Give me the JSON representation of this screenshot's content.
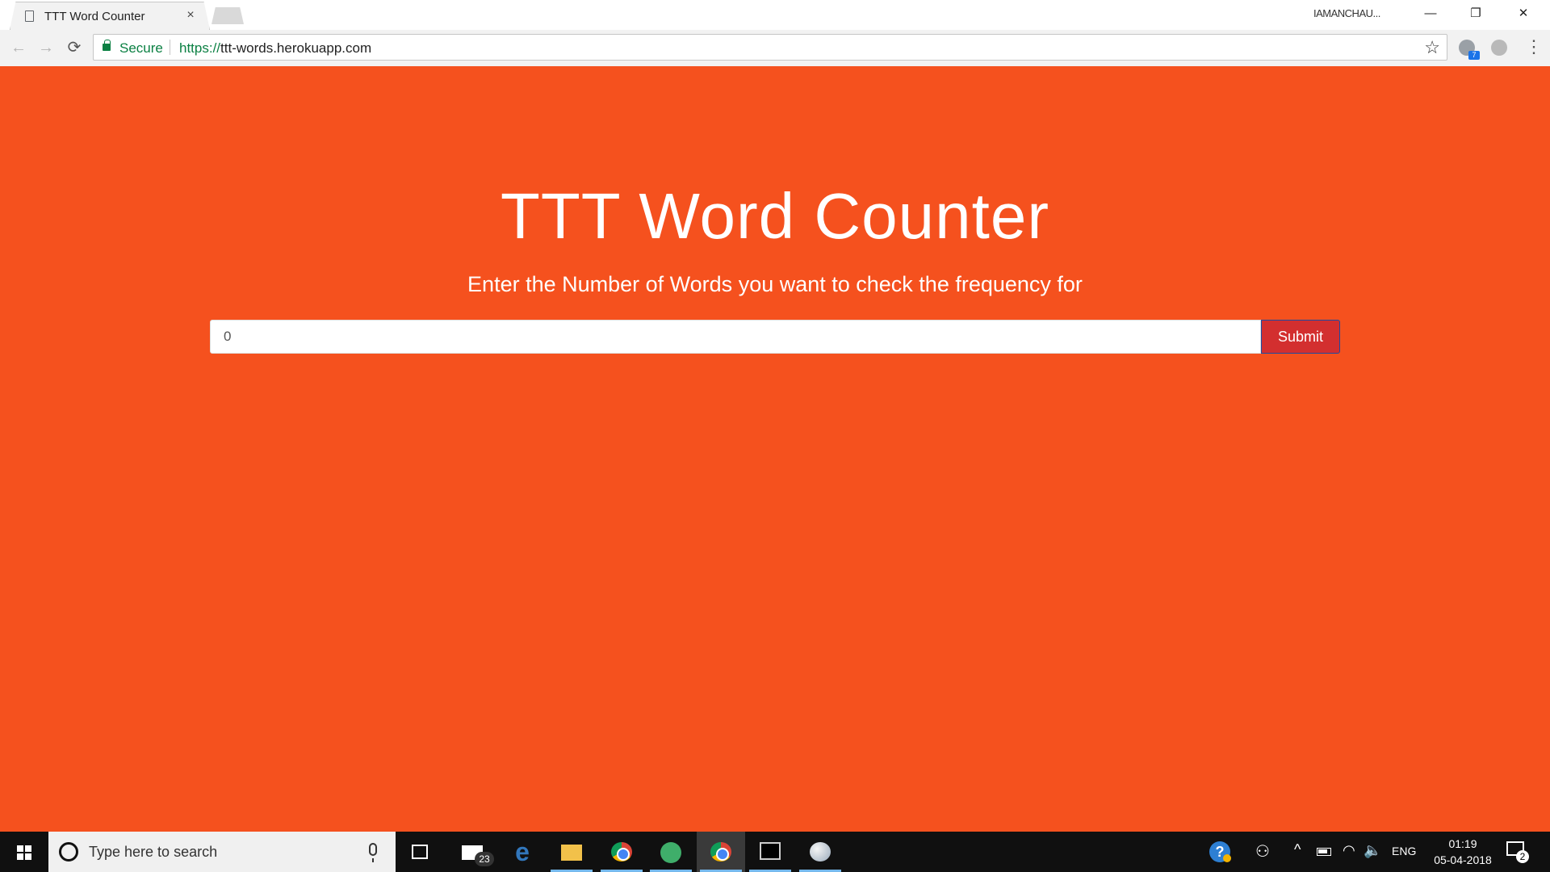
{
  "browser": {
    "tab_title": "TTT Word Counter",
    "tab_close": "×",
    "profile_name": "IAMANCHAU...",
    "window_controls": {
      "minimize": "—",
      "maximize": "❐",
      "close": "✕"
    },
    "nav": {
      "back": "←",
      "forward": "→",
      "reload": "⟳"
    },
    "security_label": "Secure",
    "url_scheme": "https://",
    "url_host": "ttt-words.herokuapp.com",
    "extension_badge": "7",
    "menu": "⋮",
    "star": "☆"
  },
  "page": {
    "background_color": "#f5511e",
    "title": "TTT Word Counter",
    "subtitle": "Enter the Number of Words you want to check the frequency for",
    "input_value": "0",
    "submit_label": "Submit",
    "submit_color": "#d32f2f"
  },
  "taskbar": {
    "search_placeholder": "Type here to search",
    "mail_badge": "23",
    "icons": [
      "task-view-icon",
      "mail-icon",
      "edge-icon",
      "file-explorer-icon",
      "chrome-icon",
      "atom-icon",
      "chrome-icon",
      "terminal-icon",
      "paint-icon"
    ],
    "tray": {
      "help": "?",
      "people": "⚇",
      "chevron": "^",
      "wifi": "◠",
      "volume": "🔈",
      "language": "ENG",
      "time": "01:19",
      "date": "05-04-2018",
      "notification_count": "2"
    }
  }
}
